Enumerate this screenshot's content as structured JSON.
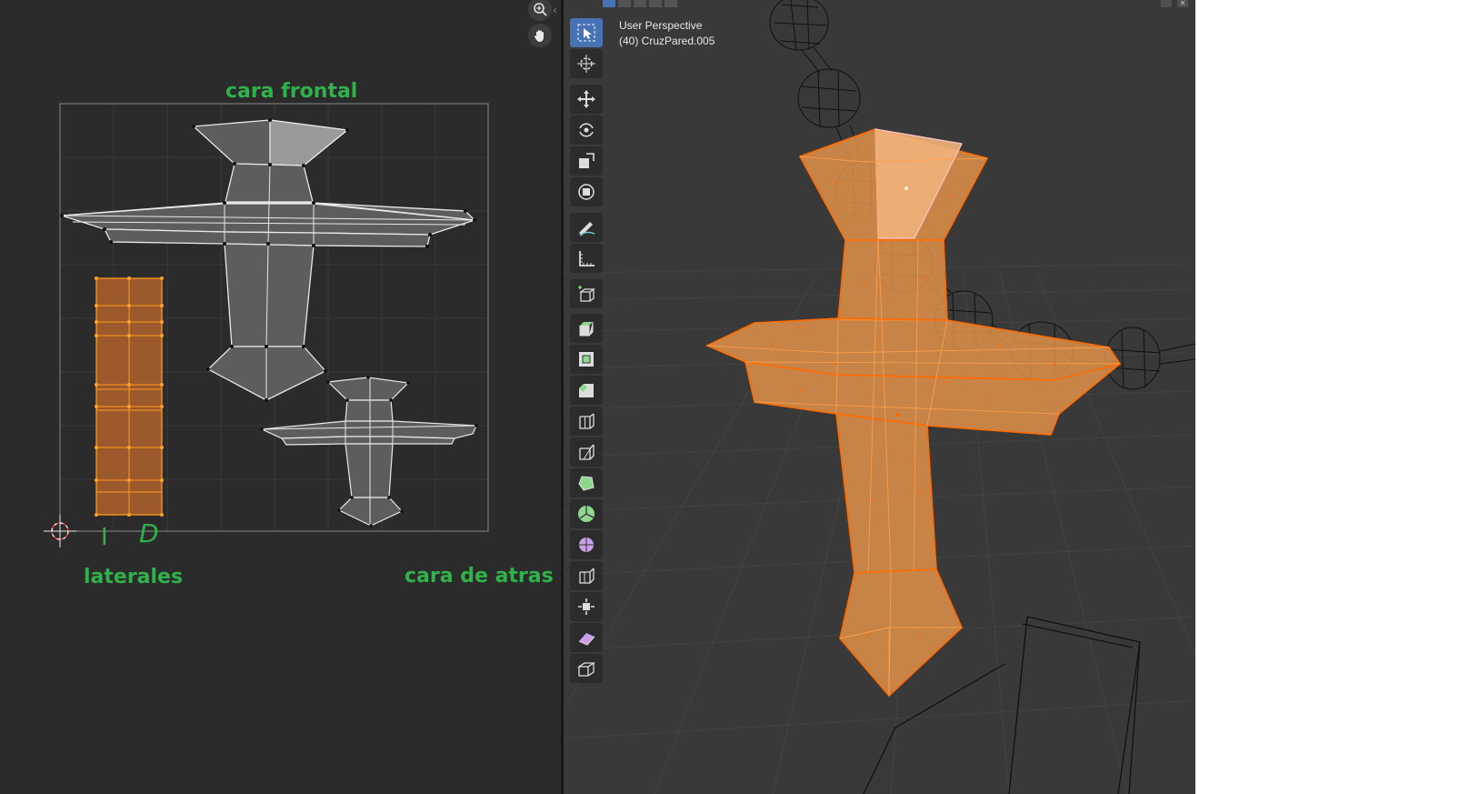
{
  "uv_editor": {
    "annotations": {
      "front": "cara frontal",
      "sides": "laterales",
      "back": "cara de atras",
      "side_left_mark": "I",
      "side_right_mark": "D"
    },
    "colors": {
      "background": "#2b2b2b",
      "uv_bounds": "#8a8a8a",
      "face_fill": "#5d5d5d",
      "selected_face": "#9c5a2c",
      "selected_edge": "#ff9a1e",
      "annotation_text": "#2fb24a"
    },
    "nav_icons": [
      "zoom-icon",
      "hand-pan-icon"
    ]
  },
  "viewport": {
    "info_line1": "User Perspective",
    "info_line2": "(40) CruzPared.005",
    "tools": [
      {
        "name": "select-box-tool",
        "active": true
      },
      {
        "name": "cursor-tool",
        "active": false
      },
      {
        "name": "move-tool",
        "active": false
      },
      {
        "name": "rotate-tool",
        "active": false
      },
      {
        "name": "scale-tool",
        "active": false
      },
      {
        "name": "transform-tool",
        "active": false
      },
      {
        "name": "annotate-tool",
        "active": false
      },
      {
        "name": "measure-tool",
        "active": false
      },
      {
        "name": "add-cube-tool",
        "active": false
      },
      {
        "name": "extrude-region-tool",
        "active": false
      },
      {
        "name": "inset-faces-tool",
        "active": false
      },
      {
        "name": "bevel-tool",
        "active": false
      },
      {
        "name": "loop-cut-tool",
        "active": false
      },
      {
        "name": "knife-tool",
        "active": false
      },
      {
        "name": "poly-build-tool",
        "active": false
      },
      {
        "name": "spin-tool",
        "active": false
      },
      {
        "name": "smooth-tool",
        "active": false
      },
      {
        "name": "edge-slide-tool",
        "active": false
      },
      {
        "name": "shrink-fatten-tool",
        "active": false
      },
      {
        "name": "shear-tool",
        "active": false
      },
      {
        "name": "rip-region-tool",
        "active": false
      }
    ],
    "colors": {
      "background": "#393939",
      "mesh_fill": "#e8944a",
      "mesh_edge": "#ff6a00",
      "active_face": "#f0b27a",
      "wire": "#111111"
    }
  }
}
